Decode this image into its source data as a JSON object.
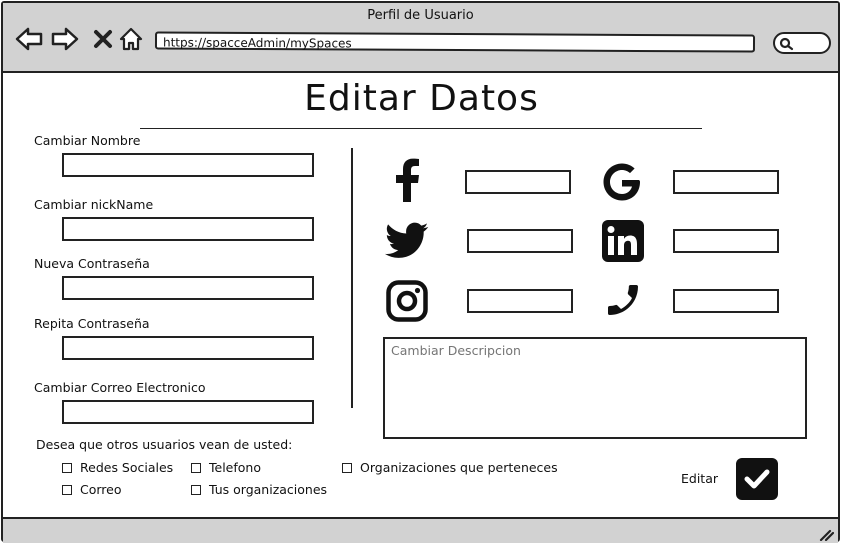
{
  "window": {
    "title": "Perfil de Usuario"
  },
  "browser": {
    "url": "https://spacceAdmin/mySpaces"
  },
  "page": {
    "title": "Editar Datos"
  },
  "form": {
    "fields": [
      {
        "label": "Cambiar Nombre",
        "value": ""
      },
      {
        "label": "Cambiar nickName",
        "value": ""
      },
      {
        "label": "Nueva Contraseña",
        "value": ""
      },
      {
        "label": "Repita Contraseña",
        "value": ""
      },
      {
        "label": "Cambiar Correo Electronico",
        "value": ""
      }
    ]
  },
  "social": {
    "items": [
      {
        "icon": "facebook-icon",
        "value": ""
      },
      {
        "icon": "google-icon",
        "value": ""
      },
      {
        "icon": "twitter-icon",
        "value": ""
      },
      {
        "icon": "linkedin-icon",
        "value": ""
      },
      {
        "icon": "instagram-icon",
        "value": ""
      },
      {
        "icon": "phone-icon",
        "value": ""
      }
    ],
    "description_label": "Cambiar Descripcion"
  },
  "visibility": {
    "prompt": "Desea que otros usuarios vean de usted:",
    "options": [
      {
        "label": "Redes Sociales",
        "checked": false
      },
      {
        "label": "Telefono",
        "checked": false
      },
      {
        "label": "Organizaciones que perteneces",
        "checked": false
      },
      {
        "label": "Correo",
        "checked": false
      },
      {
        "label": "Tus organizaciones",
        "checked": false
      }
    ]
  },
  "actions": {
    "edit_label": "Editar"
  },
  "colors": {
    "chrome": "#d2d2d2",
    "ink": "#111111"
  }
}
